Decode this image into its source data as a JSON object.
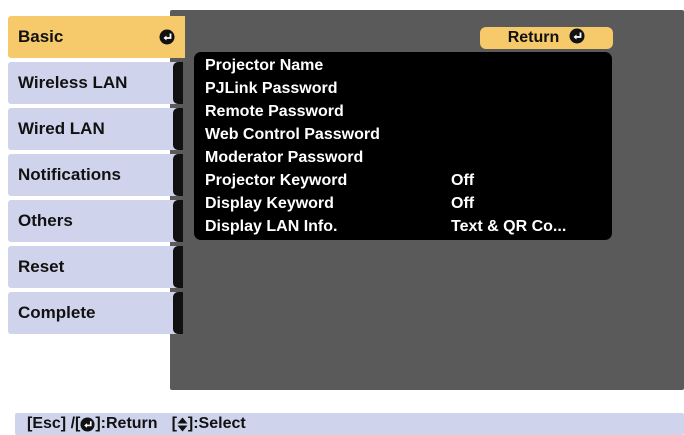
{
  "sidebar": {
    "items": [
      {
        "label": "Basic",
        "active": true
      },
      {
        "label": "Wireless LAN",
        "active": false
      },
      {
        "label": "Wired LAN",
        "active": false
      },
      {
        "label": "Notifications",
        "active": false
      },
      {
        "label": "Others",
        "active": false
      },
      {
        "label": "Reset",
        "active": false
      },
      {
        "label": "Complete",
        "active": false
      }
    ]
  },
  "return_button": {
    "label": "Return",
    "icon": "enter-icon"
  },
  "menu": [
    {
      "label": "Projector Name",
      "value": ""
    },
    {
      "label": "PJLink Password",
      "value": ""
    },
    {
      "label": "Remote Password",
      "value": ""
    },
    {
      "label": "Web Control Password",
      "value": ""
    },
    {
      "label": "Moderator Password",
      "value": ""
    },
    {
      "label": "Projector Keyword",
      "value": "Off"
    },
    {
      "label": "Display Keyword",
      "value": "Off"
    },
    {
      "label": "Display LAN Info.",
      "value": "Text & QR Co..."
    }
  ],
  "status_bar": {
    "esc": "[Esc] /[",
    "return": "]:Return",
    "select_open": "[",
    "select": "]:Select"
  },
  "colors": {
    "accent": "#f6c96b",
    "tab_bg": "#cfd4ec",
    "panel_bg": "#5a5a5a",
    "list_bg": "#000000"
  }
}
